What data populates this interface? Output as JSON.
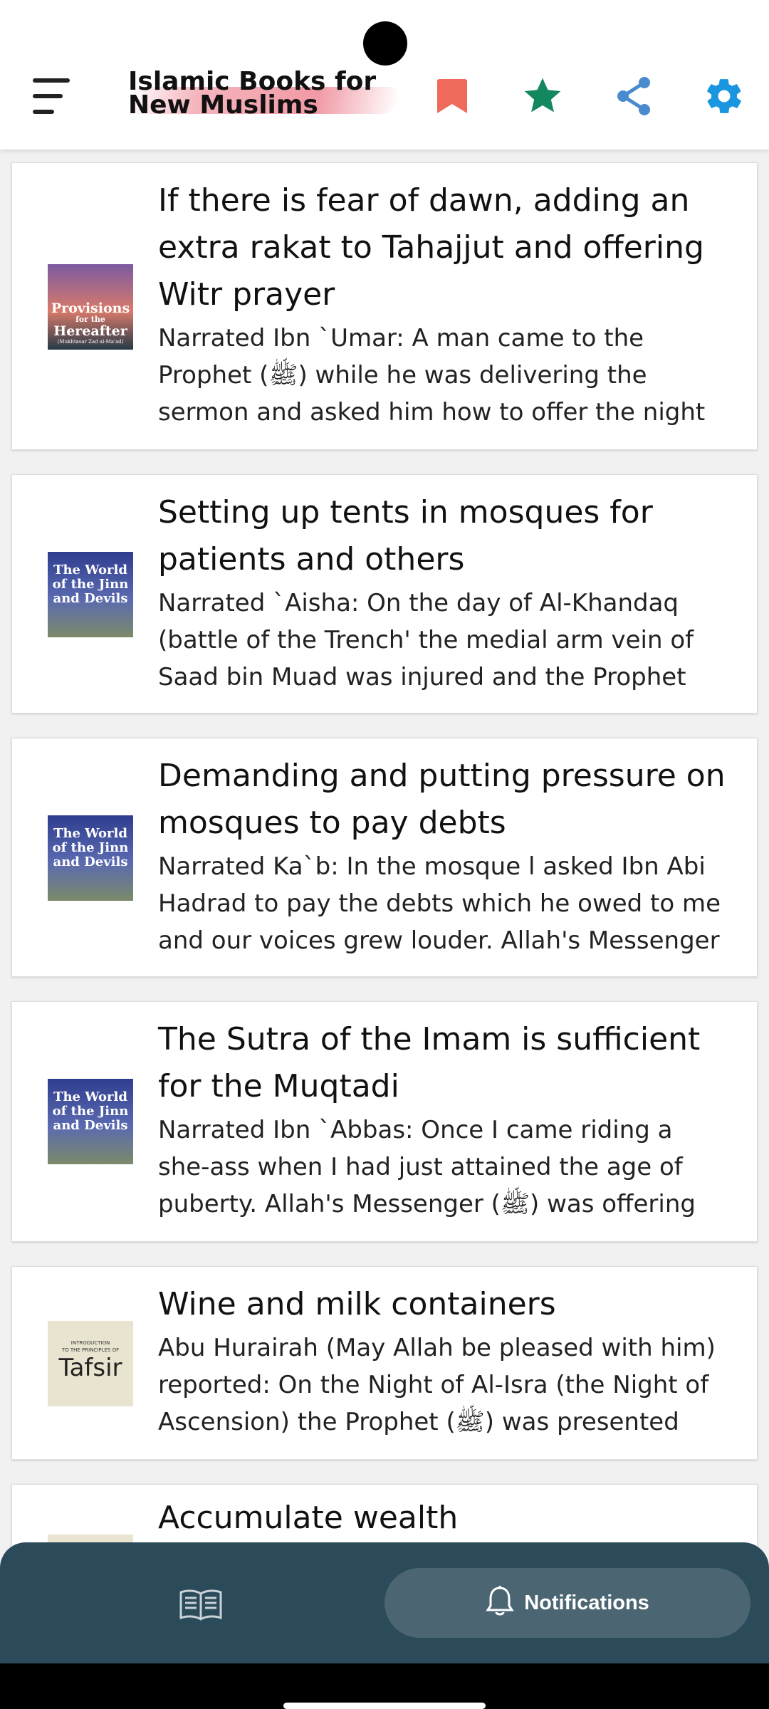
{
  "app": {
    "title": "Islamic Books for New Muslims"
  },
  "header": {
    "icons": [
      "menu-icon",
      "bookmark-icon",
      "star-icon",
      "share-icon",
      "gear-icon"
    ],
    "colors": {
      "bookmark": "#ef6a5a",
      "star": "#13875e",
      "share": "#4a8bd0",
      "gear": "#1a96e0"
    }
  },
  "items": [
    {
      "title_lines": [
        "If there is fear of dawn, adding an",
        "extra rakat to Tahajjut and offering",
        "Witr prayer"
      ],
      "body_lines": [
        "Narrated Ibn `Umar: A man came to the",
        "Prophet (ﷺ) while he was delivering the",
        "sermon and asked him how to offer the night"
      ],
      "thumb": {
        "cover_lines": [
          "Provisions",
          "for the",
          "Hereafter"
        ],
        "subtitle": "(Mukhtasar Zad al-Ma'ad)"
      }
    },
    {
      "title_lines": [
        "Setting up tents in mosques for",
        "patients and others"
      ],
      "body_lines": [
        "Narrated `Aisha: On the day of Al-Khandaq",
        "(battle of the Trench' the medial arm vein of",
        "Saad bin Muad was injured and the Prophet"
      ],
      "thumb": {
        "cover_lines": [
          "The World",
          "of the Jinn",
          "and Devils"
        ]
      }
    },
    {
      "title_lines": [
        "Demanding and putting pressure on",
        "mosques to pay debts"
      ],
      "body_lines": [
        "Narrated Ka`b: In the mosque l asked Ibn Abi",
        "Hadrad to pay the debts which he owed to me",
        "and our voices grew louder. Allah's Messenger"
      ],
      "thumb": {
        "cover_lines": [
          "The World",
          "of the Jinn",
          "and Devils"
        ]
      }
    },
    {
      "title_lines": [
        "The Sutra of the Imam is sufficient",
        "for the Muqtadi"
      ],
      "body_lines": [
        "Narrated Ibn `Abbas: Once I came riding a",
        "she-ass when I had just attained the age of",
        "puberty. Allah's Messenger (ﷺ) was offering"
      ],
      "thumb": {
        "cover_lines": [
          "The World",
          "of the Jinn",
          "and Devils"
        ]
      }
    },
    {
      "title_lines": [
        "Wine and milk containers"
      ],
      "body_lines": [
        "Abu Hurairah (May Allah be pleased with him)",
        "reported: On the Night of Al-Isra (the Night of",
        "Ascension) the Prophet (ﷺ) was presented"
      ],
      "thumb": {
        "cover_lines": [
          "INTRODUCTION",
          "TO THE PRINCIPLES OF",
          "Tafsir"
        ]
      }
    },
    {
      "title_lines": [
        "Accumulate wealth"
      ],
      "body_lines": [],
      "thumb": {
        "cover_lines": []
      }
    }
  ],
  "bottom_nav": {
    "books_icon": "book-open-icon",
    "notifications_icon": "bell-icon",
    "notifications_label": "Notifications"
  }
}
